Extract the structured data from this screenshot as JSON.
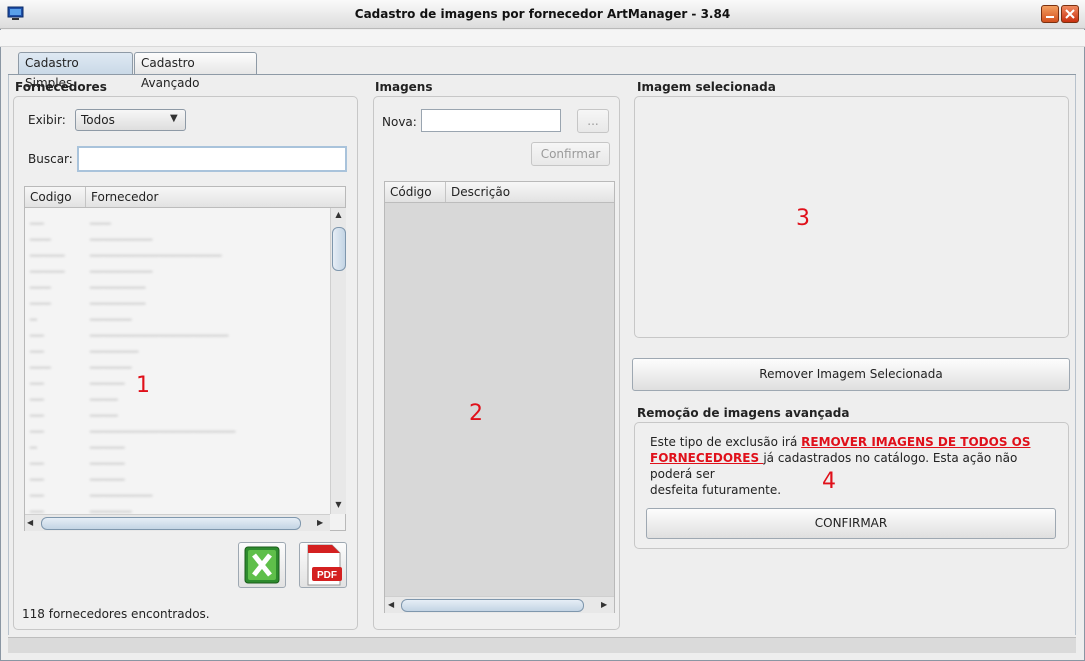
{
  "window": {
    "title": "Cadastro de imagens por fornecedor ArtManager - 3.84"
  },
  "tabs": [
    {
      "label": "Cadastro Simples"
    },
    {
      "label": "Cadastro Avançado"
    }
  ],
  "fornecedores": {
    "title": "Fornecedores",
    "exibir_label": "Exibir:",
    "exibir_value": "Todos",
    "buscar_label": "Buscar:",
    "buscar_value": "",
    "columns": [
      "Codigo",
      "Fornecedor"
    ],
    "status": "118 fornecedores encontrados.",
    "marker": "1",
    "excel_icon": "excel-icon",
    "pdf_icon": "pdf-icon",
    "pdf_label": "PDF"
  },
  "imagens": {
    "title": "Imagens",
    "nova_label": "Nova:",
    "nova_value": "",
    "browse_label": "...",
    "confirmar_label": "Confirmar",
    "columns": [
      "Código",
      "Descrição"
    ],
    "marker": "2"
  },
  "imagem_selecionada": {
    "title": "Imagem selecionada",
    "marker": "3",
    "remover_label": "Remover Imagem Selecionada"
  },
  "remocao": {
    "title": "Remoção de imagens avançada",
    "text_pre": "Este tipo de exclusão irá ",
    "text_warn_1": "REMOVER IMAGENS DE TODOS OS",
    "text_warn_2": "FORNECEDORES ",
    "text_post_1": "já cadastrados no catálogo. Esta ação não poderá ser",
    "text_post_2": "desfeita futuramente.",
    "marker": "4",
    "confirmar_label": "CONFIRMAR"
  },
  "colors": {
    "marker": "#e0101a",
    "selected_tab": "#c9d8e6"
  }
}
